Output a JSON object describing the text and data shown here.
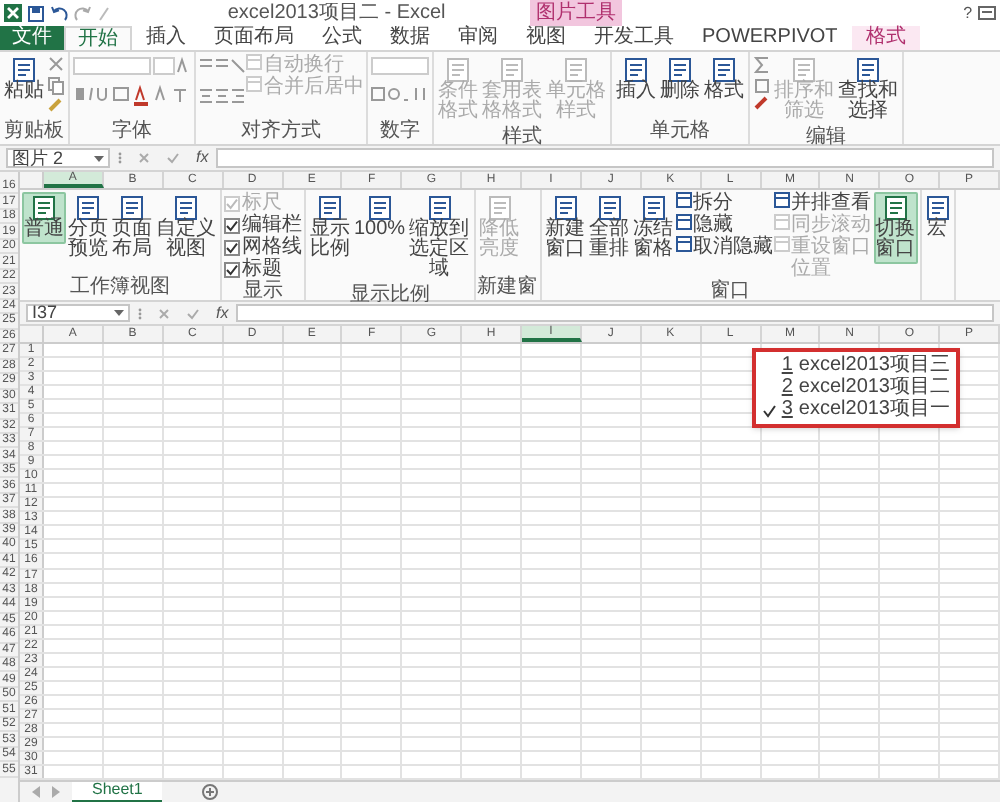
{
  "title_bar": {
    "title": "excel2013项目二 - Excel",
    "context_label": "图片工具",
    "help": "?"
  },
  "tabs": [
    {
      "label": "文件",
      "kind": "file",
      "selected": false
    },
    {
      "label": "开始",
      "kind": "tab",
      "selected": true
    },
    {
      "label": "插入",
      "kind": "tab",
      "selected": false
    },
    {
      "label": "页面布局",
      "kind": "tab",
      "selected": false
    },
    {
      "label": "公式",
      "kind": "tab",
      "selected": false
    },
    {
      "label": "数据",
      "kind": "tab",
      "selected": false
    },
    {
      "label": "审阅",
      "kind": "tab",
      "selected": false
    },
    {
      "label": "视图",
      "kind": "tab",
      "selected": false
    },
    {
      "label": "开发工具",
      "kind": "tab",
      "selected": false
    },
    {
      "label": "POWERPIVOT",
      "kind": "tab",
      "selected": false
    },
    {
      "label": "格式",
      "kind": "context",
      "selected": false
    }
  ],
  "ribbon": {
    "groups": [
      {
        "label": "剪贴板",
        "items": [
          {
            "kind": "large",
            "label": "粘贴",
            "selected": false,
            "disabled": false
          },
          {
            "kind": "clipboard_tools"
          }
        ]
      },
      {
        "label": "字体",
        "items": [
          {
            "kind": "font_tools"
          }
        ]
      },
      {
        "label": "对齐方式",
        "items": [
          {
            "kind": "align_tools"
          },
          {
            "kind": "small_list",
            "entries": [
              {
                "label": "自动换行",
                "disabled": true
              },
              {
                "label": "合并后居中",
                "disabled": true
              }
            ]
          }
        ]
      },
      {
        "label": "数字",
        "items": [
          {
            "kind": "number_tools"
          }
        ]
      },
      {
        "label": "样式",
        "items": [
          {
            "kind": "large",
            "label": "条件格式",
            "selected": false,
            "disabled": true
          },
          {
            "kind": "large",
            "label": "套用表格格式",
            "selected": false,
            "disabled": true
          },
          {
            "kind": "large",
            "label": "单元格样式",
            "selected": false,
            "disabled": true
          }
        ]
      },
      {
        "label": "单元格",
        "items": [
          {
            "kind": "large",
            "label": "插入",
            "selected": false,
            "disabled": false
          },
          {
            "kind": "large",
            "label": "删除",
            "selected": false,
            "disabled": false
          },
          {
            "kind": "large",
            "label": "格式",
            "selected": false,
            "disabled": false
          }
        ]
      },
      {
        "label": "编辑",
        "items": [
          {
            "kind": "edit_tools"
          },
          {
            "kind": "large",
            "label": "排序和筛选",
            "selected": false,
            "disabled": true
          },
          {
            "kind": "large",
            "label": "查找和选择",
            "selected": false,
            "disabled": false
          }
        ]
      }
    ]
  },
  "formula_bar": {
    "name_box": "图片 2",
    "function_label": "fx"
  },
  "row_numbers": [
    "16",
    "17",
    "18",
    "19",
    "20",
    "21",
    "22",
    "23",
    "24",
    "25",
    "26",
    "27",
    "28",
    "29",
    "30",
    "31",
    "32",
    "33",
    "34",
    "35",
    "36",
    "37",
    "38",
    "39",
    "40",
    "41",
    "42",
    "43",
    "44",
    "45",
    "46",
    "47",
    "48",
    "49",
    "50",
    "51",
    "52",
    "53",
    "54",
    "55"
  ],
  "embedded_screenshot": {
    "column_headers": [
      {
        "label": "A",
        "selected": true
      },
      {
        "label": "B",
        "selected": false
      },
      {
        "label": "C",
        "selected": false
      },
      {
        "label": "D",
        "selected": false
      },
      {
        "label": "E",
        "selected": false
      },
      {
        "label": "F",
        "selected": false
      },
      {
        "label": "G",
        "selected": false
      },
      {
        "label": "H",
        "selected": false
      },
      {
        "label": "I",
        "selected": false
      },
      {
        "label": "J",
        "selected": false
      },
      {
        "label": "K",
        "selected": false
      },
      {
        "label": "L",
        "selected": false
      },
      {
        "label": "M",
        "selected": false
      },
      {
        "label": "N",
        "selected": false
      },
      {
        "label": "O",
        "selected": false
      },
      {
        "label": "P",
        "selected": false
      }
    ],
    "ribbon": {
      "groups": [
        {
          "label": "工作簿视图",
          "items": [
            {
              "kind": "large",
              "label": "普通",
              "selected": true,
              "disabled": false
            },
            {
              "kind": "large",
              "label": "分页预览",
              "selected": false,
              "disabled": false
            },
            {
              "kind": "large",
              "label": "页面布局",
              "selected": false,
              "disabled": false
            },
            {
              "kind": "large",
              "label": "自定义视图",
              "selected": false,
              "disabled": false
            }
          ]
        },
        {
          "label": "显示",
          "items": [
            {
              "kind": "checks",
              "entries": [
                {
                  "label": "标尺",
                  "checked": true,
                  "disabled": true
                },
                {
                  "label": "编辑栏",
                  "checked": true,
                  "disabled": false
                },
                {
                  "label": "网格线",
                  "checked": true,
                  "disabled": false
                },
                {
                  "label": "标题",
                  "checked": true,
                  "disabled": false
                }
              ]
            }
          ]
        },
        {
          "label": "显示比例",
          "items": [
            {
              "kind": "large",
              "label": "显示比例",
              "selected": false,
              "disabled": false
            },
            {
              "kind": "large",
              "label": "100%",
              "selected": false,
              "disabled": false
            },
            {
              "kind": "large",
              "label": "缩放到选定区域",
              "selected": false,
              "disabled": false
            }
          ]
        },
        {
          "label": "新建窗",
          "items": [
            {
              "kind": "large",
              "label": "降低亮度",
              "selected": false,
              "disabled": true
            }
          ]
        },
        {
          "label": "窗口",
          "items": [
            {
              "kind": "large",
              "label": "新建窗口",
              "selected": false,
              "disabled": false
            },
            {
              "kind": "large",
              "label": "全部重排",
              "selected": false,
              "disabled": false
            },
            {
              "kind": "large",
              "label": "冻结窗格",
              "selected": false,
              "disabled": false
            },
            {
              "kind": "small_list",
              "entries": [
                {
                  "label": "拆分",
                  "disabled": false
                },
                {
                  "label": "隐藏",
                  "disabled": false
                },
                {
                  "label": "取消隐藏",
                  "disabled": false
                }
              ]
            },
            {
              "kind": "small_list",
              "entries": [
                {
                  "label": "并排查看",
                  "disabled": false
                },
                {
                  "label": "同步滚动",
                  "disabled": true
                },
                {
                  "label": "重设窗口位置",
                  "disabled": true
                }
              ]
            },
            {
              "kind": "large",
              "label": "切换窗口",
              "selected": true,
              "disabled": false
            }
          ]
        },
        {
          "items": [
            {
              "kind": "large",
              "label": "宏",
              "selected": false,
              "disabled": false
            }
          ]
        }
      ]
    },
    "window_menu": [
      {
        "key": "1",
        "label": "excel2013项目三",
        "selected": false
      },
      {
        "key": "2",
        "label": "excel2013项目二",
        "selected": false
      },
      {
        "key": "3",
        "label": "excel2013项目一",
        "selected": true
      }
    ],
    "formula_bar": {
      "name_box": "I37",
      "function_label": "fx"
    },
    "column_headers_2": [
      {
        "label": "A",
        "selected": false
      },
      {
        "label": "B",
        "selected": false
      },
      {
        "label": "C",
        "selected": false
      },
      {
        "label": "D",
        "selected": false
      },
      {
        "label": "E",
        "selected": false
      },
      {
        "label": "F",
        "selected": false
      },
      {
        "label": "G",
        "selected": false
      },
      {
        "label": "H",
        "selected": false
      },
      {
        "label": "I",
        "selected": true
      },
      {
        "label": "J",
        "selected": false
      },
      {
        "label": "K",
        "selected": false
      },
      {
        "label": "L",
        "selected": false
      },
      {
        "label": "M",
        "selected": false
      },
      {
        "label": "N",
        "selected": false
      },
      {
        "label": "O",
        "selected": false
      },
      {
        "label": "P",
        "selected": false
      }
    ],
    "row_numbers": [
      "1",
      "2",
      "3",
      "4",
      "5",
      "6",
      "7",
      "8",
      "9",
      "10",
      "11",
      "12",
      "13",
      "14",
      "15",
      "16",
      "17",
      "18",
      "19",
      "20",
      "21",
      "22",
      "23",
      "24",
      "25",
      "26",
      "27",
      "28",
      "29",
      "30",
      "31"
    ],
    "sheet_tabs": [
      {
        "label": "Sheet1",
        "selected": true
      }
    ]
  }
}
